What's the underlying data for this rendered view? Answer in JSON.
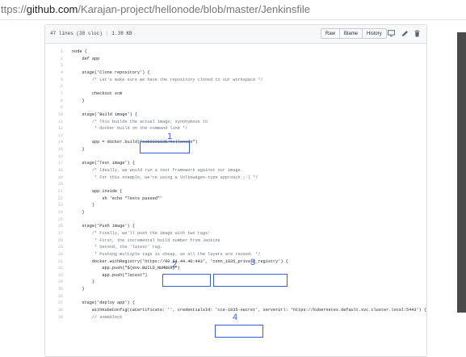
{
  "browser": {
    "url_scheme": "ttps://",
    "url_host": "github.com",
    "url_path": "/Karajan-project/hellonode/blob/master/Jenkinsfile"
  },
  "file_header": {
    "lines_info": "47 lines (38 sloc)",
    "size": "1.38 KB",
    "buttons": [
      "Raw",
      "Blame",
      "History"
    ],
    "icons": [
      "desktop-icon",
      "pencil-icon",
      "trash-icon"
    ]
  },
  "code_lines": [
    {
      "n": "1",
      "t": "node {"
    },
    {
      "n": "2",
      "t": "    def app"
    },
    {
      "n": "3",
      "t": ""
    },
    {
      "n": "4",
      "t": "    stage('Clone repository') {"
    },
    {
      "n": "5",
      "t": "        /* Let's make sure we have the repository cloned to our workspace */"
    },
    {
      "n": "6",
      "t": ""
    },
    {
      "n": "7",
      "t": "        checkout scm"
    },
    {
      "n": "8",
      "t": "    }"
    },
    {
      "n": "9",
      "t": ""
    },
    {
      "n": "10",
      "t": "    stage('Build image') {"
    },
    {
      "n": "11",
      "t": "        /* This builds the actual image; synonymous to"
    },
    {
      "n": "12",
      "t": "         * docker build on the command line */"
    },
    {
      "n": "13",
      "t": ""
    },
    {
      "n": "14",
      "t": "        app = docker.build(\"ocb0001835/hellonode\")"
    },
    {
      "n": "15",
      "t": "    }"
    },
    {
      "n": "16",
      "t": ""
    },
    {
      "n": "17",
      "t": "    stage('Test image') {"
    },
    {
      "n": "18",
      "t": "        /* Ideally, we would run a test framework against our image."
    },
    {
      "n": "19",
      "t": "         * For this example, we're using a Volkswagen-type approach ;-) */"
    },
    {
      "n": "20",
      "t": ""
    },
    {
      "n": "21",
      "t": "        app.inside {"
    },
    {
      "n": "22",
      "t": "            sh 'echo \"Tests passed\"'"
    },
    {
      "n": "23",
      "t": "        }"
    },
    {
      "n": "24",
      "t": "    }"
    },
    {
      "n": "25",
      "t": ""
    },
    {
      "n": "26",
      "t": "    stage('Push image') {"
    },
    {
      "n": "27",
      "t": "        /* Finally, we'll push the image with two tags:"
    },
    {
      "n": "28",
      "t": "         * First, the incremental build number from Jenkins"
    },
    {
      "n": "29",
      "t": "         * Second, the 'latest' tag."
    },
    {
      "n": "30",
      "t": "         * Pushing multiple tags is cheap, as all the layers are reused. */"
    },
    {
      "n": "31",
      "t": "        docker.withRegistry('https://90.84.44.40:443', 'conn_1835_private_registry') {"
    },
    {
      "n": "32",
      "t": "            app.push(\"${env.BUILD_NUMBER}\")"
    },
    {
      "n": "33",
      "t": "            app.push(\"latest\")"
    },
    {
      "n": "34",
      "t": "        }"
    },
    {
      "n": "35",
      "t": "    }"
    },
    {
      "n": "36",
      "t": ""
    },
    {
      "n": "37",
      "t": "    stage('deploy app') {"
    },
    {
      "n": "38",
      "t": "        withKubeConfig(caCertificate: '', credentialsId: 'cce-1835-secret', serverUrl: 'https://kubernetes.default.svc.cluster.local:5443') {"
    },
    {
      "n": "39",
      "t": "        // someblock"
    }
  ],
  "annotations": [
    "1",
    "2",
    "3",
    "4"
  ],
  "colors": {
    "annotation": "#3d5fd6",
    "keyword": "#d73a49",
    "string": "#032f62",
    "comment": "#6a737d"
  }
}
